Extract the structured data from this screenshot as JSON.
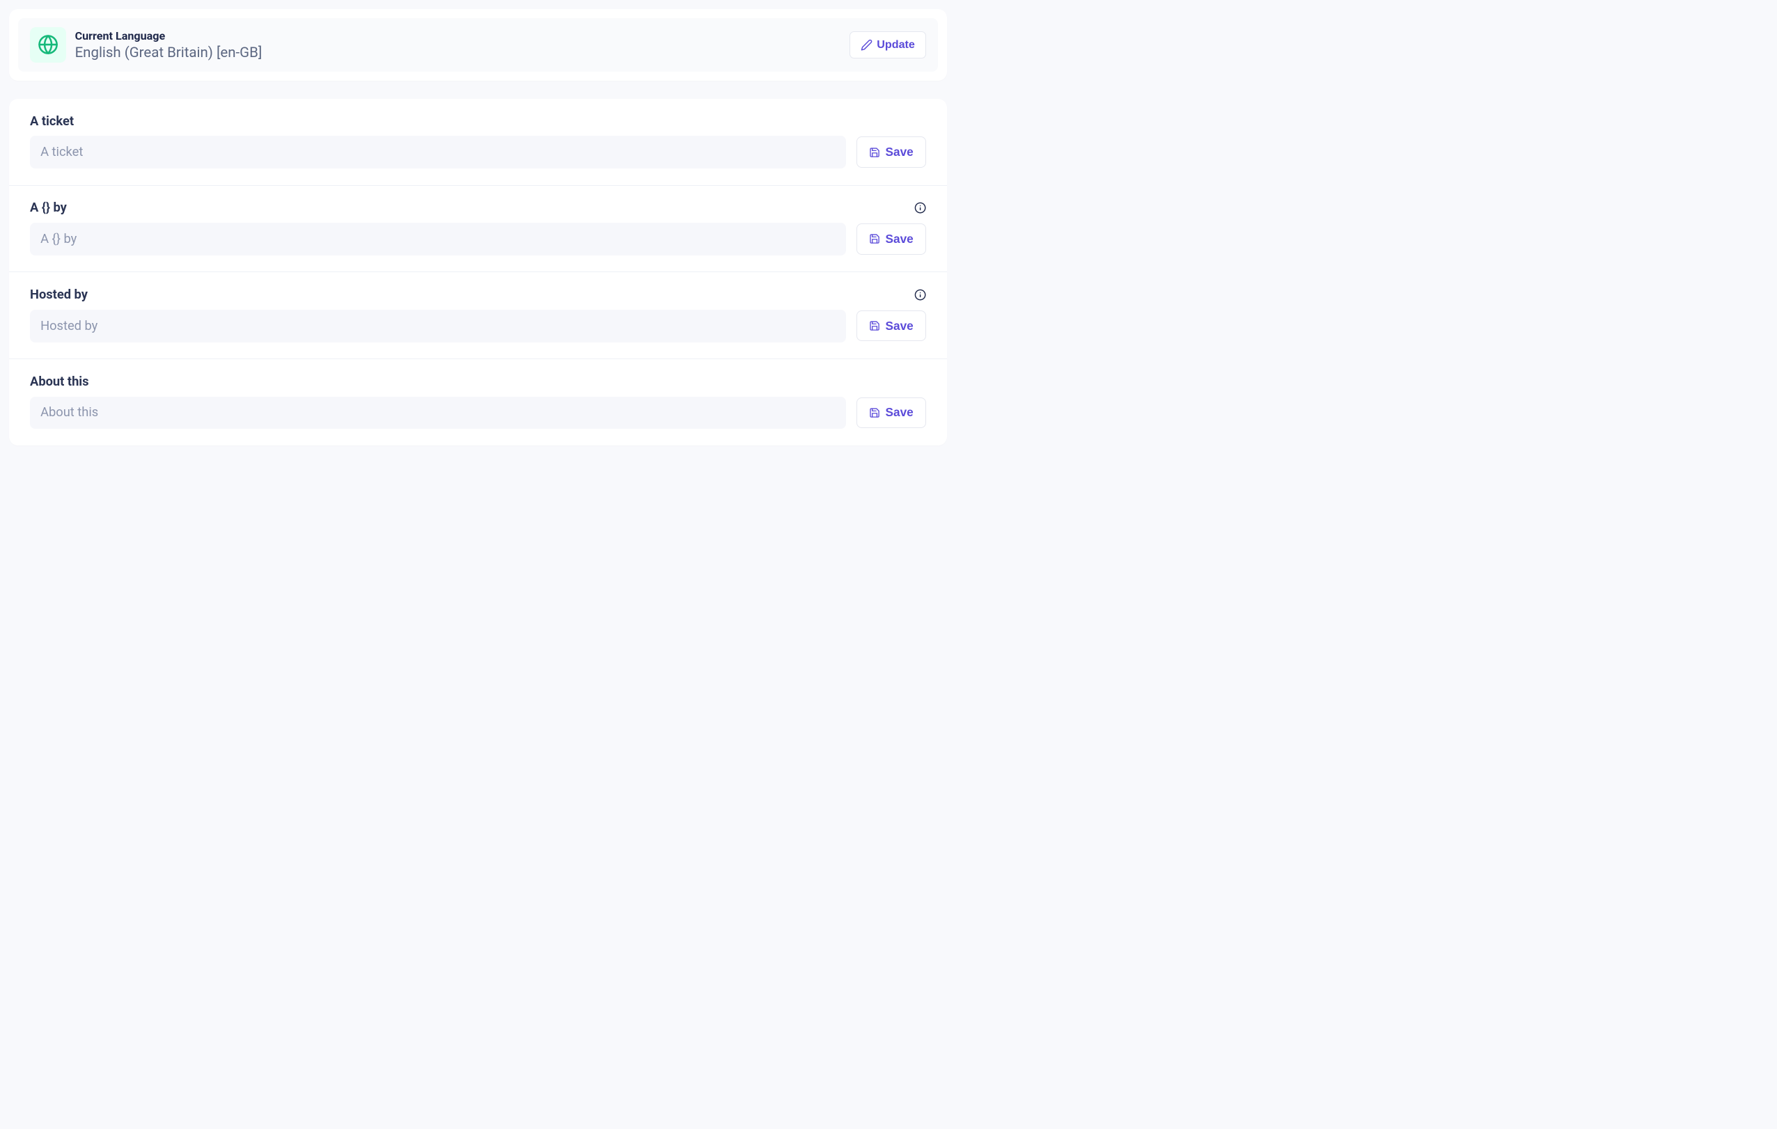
{
  "language": {
    "label": "Current Language",
    "value": "English (Great Britain) [en-GB]",
    "update_label": "Update"
  },
  "save_label": "Save",
  "rows": [
    {
      "label": "A ticket",
      "placeholder": "A ticket",
      "value": "",
      "has_info": false
    },
    {
      "label": "A {} by",
      "placeholder": "A {} by",
      "value": "",
      "has_info": true
    },
    {
      "label": "Hosted by",
      "placeholder": "Hosted by",
      "value": "",
      "has_info": true
    },
    {
      "label": "About this",
      "placeholder": "About this",
      "value": "",
      "has_info": false
    }
  ]
}
